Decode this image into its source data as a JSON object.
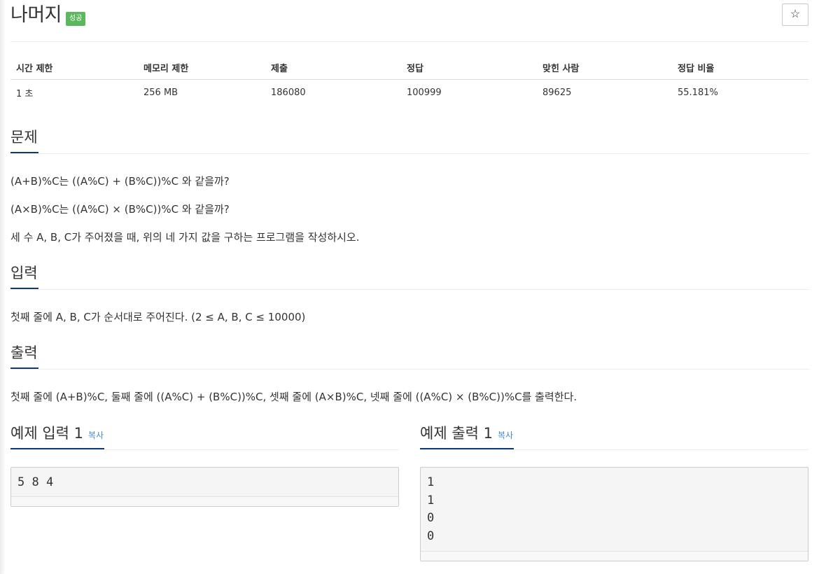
{
  "problem": {
    "title": "나머지",
    "status_badge": "성공",
    "star_icon": "☆"
  },
  "info_table": {
    "headers": [
      "시간 제한",
      "메모리 제한",
      "제출",
      "정답",
      "맞힌 사람",
      "정답 비율"
    ],
    "values": [
      "1 초",
      "256 MB",
      "186080",
      "100999",
      "89625",
      "55.181%"
    ]
  },
  "description": {
    "heading": "문제",
    "lines": [
      "(A+B)%C는 ((A%C) + (B%C))%C 와 같을까?",
      "(A×B)%C는 ((A%C) × (B%C))%C 와 같을까?",
      "세 수 A, B, C가 주어졌을 때, 위의 네 가지 값을 구하는 프로그램을 작성하시오."
    ]
  },
  "input": {
    "heading": "입력",
    "text": "첫째 줄에 A, B, C가 순서대로 주어진다. (2 ≤ A, B, C ≤ 10000)"
  },
  "output": {
    "heading": "출력",
    "text": "첫째 줄에 (A+B)%C, 둘째 줄에 ((A%C) + (B%C))%C, 셋째 줄에 (A×B)%C, 넷째 줄에 ((A%C) × (B%C))%C를 출력한다."
  },
  "sample_input": {
    "heading": "예제 입력 1",
    "copy_label": "복사",
    "content": "5 8 4"
  },
  "sample_output": {
    "heading": "예제 출력 1",
    "copy_label": "복사",
    "content": "1\n1\n0\n0"
  },
  "colors": {
    "badge": "#5cb85c",
    "link": "#428bca",
    "heading_underline": "#0d3a72"
  }
}
